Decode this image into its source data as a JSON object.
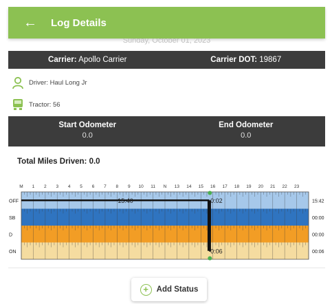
{
  "header": {
    "title": "Log Details",
    "back_glyph": "←",
    "hidden_text": "Sunday, October 01, 2023"
  },
  "carrier": {
    "label": "Carrier:",
    "value": "Apollo Carrier",
    "dot_label": "Carrier DOT:",
    "dot_value": "19867"
  },
  "driver": {
    "label": "Driver:",
    "value": "Haul Long Jr"
  },
  "tractor": {
    "label": "Tractor:",
    "value": "56"
  },
  "odometer": {
    "start_label": "Start Odometer",
    "start_value": "0.0",
    "end_label": "End Odometer",
    "end_value": "0.0"
  },
  "total_miles": {
    "label": "Total Miles Driven:",
    "value": "0.0"
  },
  "chart_data": {
    "type": "table",
    "hours": [
      "M",
      "1",
      "2",
      "3",
      "4",
      "5",
      "6",
      "7",
      "8",
      "9",
      "10",
      "11",
      "N",
      "13",
      "14",
      "15",
      "16",
      "17",
      "18",
      "19",
      "20",
      "21",
      "22",
      "23"
    ],
    "rows": [
      {
        "name": "OFF",
        "total": "15:42",
        "color": "#a6c8ea"
      },
      {
        "name": "SB",
        "total": "00:00",
        "color": "#2f74c0"
      },
      {
        "name": "D",
        "total": "00:00",
        "color": "#f29d25"
      },
      {
        "name": "ON",
        "total": "00:06",
        "color": "#f5dca0"
      }
    ],
    "segments": [
      {
        "status": "OFF",
        "start": 0,
        "end": 15.7
      },
      {
        "status": "ON",
        "start": 15.7,
        "end": 15.8
      }
    ],
    "annotations": [
      {
        "text": "15:40",
        "hour": 8.05,
        "row": "OFF"
      },
      {
        "text": "0:02",
        "hour": 15.8,
        "row": "OFF"
      },
      {
        "text": "0:06",
        "hour": 15.8,
        "row": "ON"
      }
    ],
    "current_hour": 15.75,
    "line_color": "#111111",
    "marker_color": "#4caf50"
  },
  "actions": {
    "add_status": "Add Status"
  },
  "colors": {
    "brand": "#8cc152",
    "dark_bar": "#3c3c3c"
  }
}
